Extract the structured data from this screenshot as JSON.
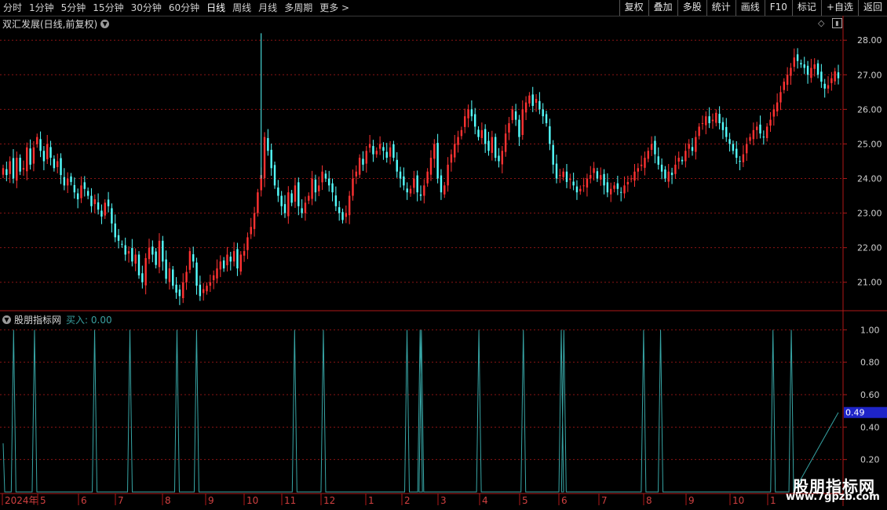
{
  "toolbar": {
    "periods": [
      "分时",
      "1分钟",
      "5分钟",
      "15分钟",
      "30分钟",
      "60分钟",
      "日线",
      "周线",
      "月线",
      "多周期",
      "更多 >"
    ],
    "active_period": "日线",
    "actions": [
      "复权",
      "叠加",
      "多股",
      "统计",
      "画线",
      "F10",
      "标记",
      "+自选",
      "返回"
    ]
  },
  "main_panel": {
    "title": "双汇发展(日线,前复权)",
    "price_axis": [
      "28.00",
      "27.00",
      "26.00",
      "25.00",
      "24.00",
      "23.00",
      "22.00",
      "21.00"
    ]
  },
  "indicator_panel": {
    "name": "股朋指标网",
    "buy_text": "买入: 0.00",
    "axis": [
      "1.00",
      "0.80",
      "0.60",
      "0.40",
      "0.20"
    ],
    "current_value": "0.49"
  },
  "time_axis": [
    "2024年",
    "5",
    "6",
    "7",
    "8",
    "9",
    "10",
    "11",
    "12",
    "1",
    "2",
    "3",
    "4",
    "5",
    "6",
    "7",
    "8",
    "9",
    "10",
    "1"
  ],
  "watermark": {
    "line1": "股朋指标网",
    "line2": "www.7gpzb.com"
  },
  "colors": {
    "up": "#ff3232",
    "down": "#54ffff",
    "indicator": "#37a5a5",
    "accent_box": "#1e24c8"
  },
  "chart_data": [
    {
      "type": "candlestick",
      "title": "双汇发展(日线,前复权)",
      "ylim": [
        20.2,
        28.3
      ],
      "x": [
        "2024年",
        "5",
        "6",
        "7",
        "8",
        "9",
        "10",
        "11",
        "12",
        "1",
        "2",
        "3",
        "4",
        "5",
        "6",
        "7",
        "8",
        "9",
        "10",
        "1"
      ],
      "series": [
        {
          "values": [
            24.3,
            24.1,
            24.5,
            24.0,
            24.6,
            24.2,
            24.3,
            24.9,
            24.4,
            24.9,
            25.2,
            24.8,
            24.5,
            25.0,
            24.6,
            24.3,
            24.5,
            24.1,
            23.8,
            24.0,
            23.9,
            23.6,
            23.4,
            23.8,
            23.7,
            23.5,
            23.2,
            23.4,
            23.1,
            22.9,
            23.3,
            23.2,
            22.7,
            22.3,
            22.2,
            22.1,
            21.8,
            21.9,
            21.6,
            21.8,
            21.2,
            21.0,
            21.7,
            22.0,
            21.8,
            21.5,
            22.2,
            21.6,
            21.1,
            21.4,
            20.9,
            20.7,
            20.6,
            21.0,
            21.3,
            21.9,
            21.6,
            20.9,
            20.6,
            20.8,
            20.9,
            21.0,
            21.2,
            21.4,
            21.6,
            21.4,
            21.8,
            21.6,
            21.9,
            21.4,
            21.8,
            21.9,
            22.3,
            22.6,
            23.0,
            23.6,
            24.1,
            25.2,
            24.8,
            24.3,
            23.8,
            23.5,
            23.2,
            23.0,
            23.6,
            23.3,
            23.8,
            23.2,
            23.0,
            23.3,
            23.5,
            24.0,
            23.6,
            23.8,
            24.2,
            24.0,
            23.8,
            23.6,
            23.2,
            23.0,
            22.8,
            23.0,
            23.5,
            24.0,
            24.2,
            24.6,
            24.4,
            24.8,
            25.0,
            24.7,
            24.8,
            25.0,
            24.8,
            24.6,
            24.9,
            24.6,
            24.2,
            24.0,
            23.8,
            23.6,
            23.7,
            24.0,
            23.6,
            23.5,
            23.8,
            24.2,
            24.6,
            25.0,
            24.0,
            23.6,
            23.8,
            24.4,
            24.7,
            25.0,
            25.2,
            25.4,
            25.8,
            26.0,
            25.8,
            25.5,
            25.2,
            25.4,
            25.0,
            24.8,
            25.2,
            24.6,
            24.5,
            24.8,
            25.3,
            25.6,
            26.0,
            25.7,
            25.2,
            26.0,
            26.2,
            26.4,
            26.1,
            26.3,
            26.0,
            25.8,
            25.6,
            25.0,
            24.4,
            24.0,
            24.1,
            24.2,
            23.9,
            24.0,
            23.8,
            23.6,
            23.7,
            23.8,
            24.0,
            24.1,
            24.3,
            24.0,
            24.1,
            23.8,
            23.6,
            23.7,
            23.8,
            23.7,
            23.6,
            23.8,
            23.9,
            24.0,
            24.2,
            24.3,
            24.4,
            24.6,
            24.8,
            25.0,
            24.7,
            24.4,
            24.2,
            24.0,
            24.2,
            24.1,
            24.4,
            24.6,
            24.5,
            24.8,
            25.0,
            24.8,
            25.2,
            25.5,
            25.6,
            25.8,
            25.6,
            25.7,
            25.9,
            25.6,
            25.4,
            25.2,
            25.0,
            24.8,
            24.6,
            24.5,
            24.7,
            25.0,
            25.2,
            25.4,
            25.5,
            25.3,
            25.2,
            25.5,
            25.7,
            26.0,
            26.2,
            26.5,
            26.8,
            27.0,
            27.2,
            27.5,
            27.4,
            27.3,
            27.2,
            27.0,
            27.2,
            27.3,
            27.0,
            26.8,
            26.6,
            26.7,
            26.9,
            27.1,
            26.9
          ]
        }
      ]
    },
    {
      "type": "line",
      "title": "股朋指标网",
      "ylim": [
        0.0,
        1.05
      ],
      "series": [
        {
          "spikes_at_index": [
            8,
            24,
            70,
            97,
            133,
            148,
            223,
            245,
            309,
            319,
            320,
            364,
            398,
            427,
            429,
            490,
            503,
            589,
            603
          ],
          "spike_value": 1.0,
          "base_value": 0.0
        }
      ]
    }
  ]
}
